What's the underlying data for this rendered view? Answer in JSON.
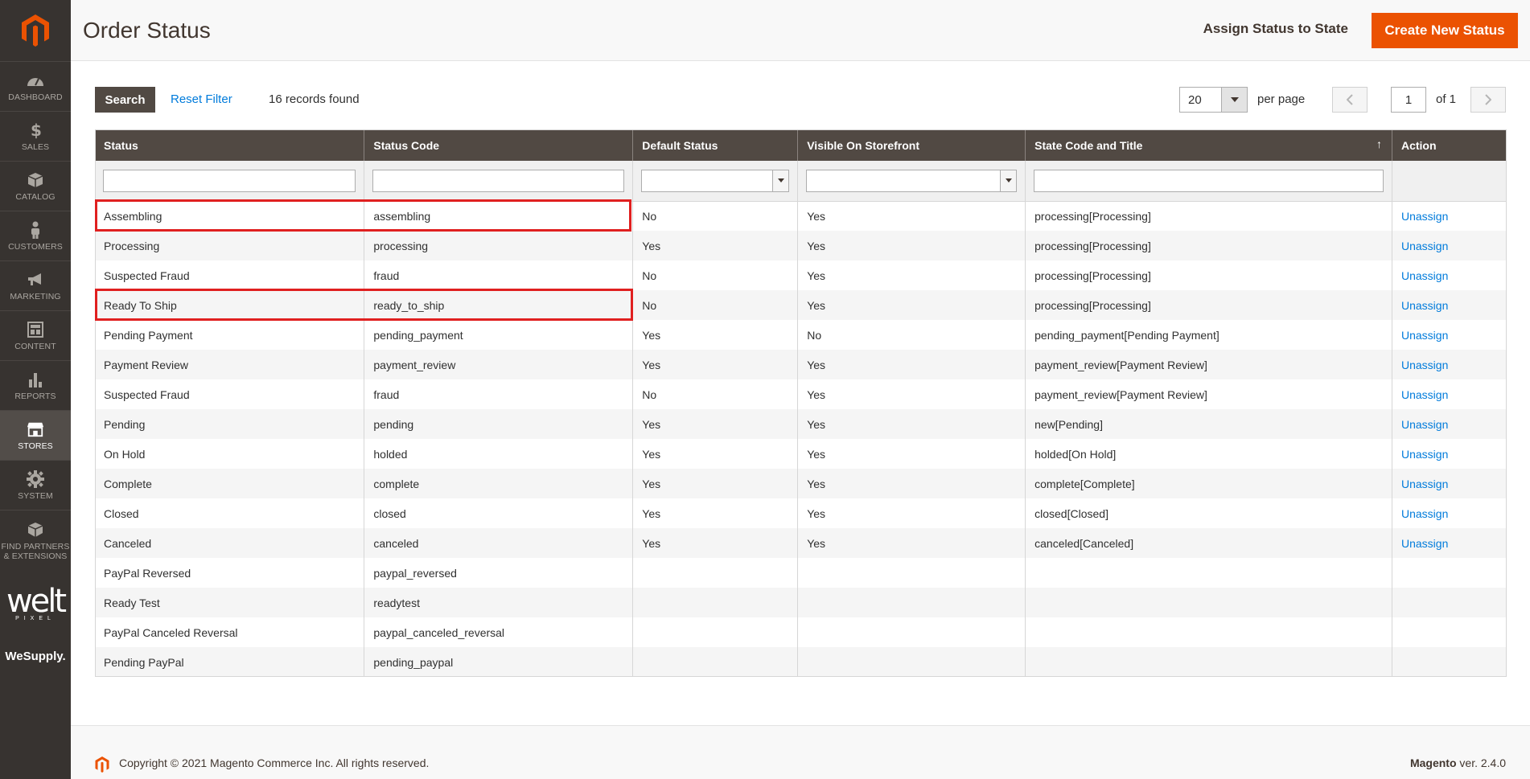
{
  "sidebar": {
    "items": [
      {
        "label": "DASHBOARD",
        "icon": "dashboard-icon",
        "active": false
      },
      {
        "label": "SALES",
        "icon": "dollar-icon",
        "active": false
      },
      {
        "label": "CATALOG",
        "icon": "box-icon",
        "active": false
      },
      {
        "label": "CUSTOMERS",
        "icon": "person-icon",
        "active": false
      },
      {
        "label": "MARKETING",
        "icon": "megaphone-icon",
        "active": false
      },
      {
        "label": "CONTENT",
        "icon": "layout-icon",
        "active": false
      },
      {
        "label": "REPORTS",
        "icon": "bar-chart-icon",
        "active": false
      },
      {
        "label": "STORES",
        "icon": "storefront-icon",
        "active": true
      },
      {
        "label": "SYSTEM",
        "icon": "gear-icon",
        "active": false
      },
      {
        "label": "FIND PARTNERS & EXTENSIONS",
        "icon": "cube-stack-icon",
        "active": false
      }
    ],
    "brand_welt": "welt",
    "brand_welt_sub": "PIXEL",
    "brand_wesupply": "WeSupply."
  },
  "header": {
    "title": "Order Status",
    "assign_label": "Assign Status to State",
    "create_label": "Create New Status"
  },
  "toolbar": {
    "search_label": "Search",
    "reset_label": "Reset Filter",
    "records_text": "16 records found",
    "per_page_value": "20",
    "per_page_label": "per page",
    "page_value": "1",
    "of_pages": "of 1"
  },
  "grid": {
    "columns": [
      "Status",
      "Status Code",
      "Default Status",
      "Visible On Storefront",
      "State Code and Title",
      "Action"
    ],
    "rows": [
      {
        "status": "Assembling",
        "code": "assembling",
        "default": "No",
        "visible": "Yes",
        "state": "processing[Processing]",
        "action": "Unassign"
      },
      {
        "status": "Processing",
        "code": "processing",
        "default": "Yes",
        "visible": "Yes",
        "state": "processing[Processing]",
        "action": "Unassign"
      },
      {
        "status": "Suspected Fraud",
        "code": "fraud",
        "default": "No",
        "visible": "Yes",
        "state": "processing[Processing]",
        "action": "Unassign"
      },
      {
        "status": "Ready To Ship",
        "code": "ready_to_ship",
        "default": "No",
        "visible": "Yes",
        "state": "processing[Processing]",
        "action": "Unassign"
      },
      {
        "status": "Pending Payment",
        "code": "pending_payment",
        "default": "Yes",
        "visible": "No",
        "state": "pending_payment[Pending Payment]",
        "action": "Unassign"
      },
      {
        "status": "Payment Review",
        "code": "payment_review",
        "default": "Yes",
        "visible": "Yes",
        "state": "payment_review[Payment Review]",
        "action": "Unassign"
      },
      {
        "status": "Suspected Fraud",
        "code": "fraud",
        "default": "No",
        "visible": "Yes",
        "state": "payment_review[Payment Review]",
        "action": "Unassign"
      },
      {
        "status": "Pending",
        "code": "pending",
        "default": "Yes",
        "visible": "Yes",
        "state": "new[Pending]",
        "action": "Unassign"
      },
      {
        "status": "On Hold",
        "code": "holded",
        "default": "Yes",
        "visible": "Yes",
        "state": "holded[On Hold]",
        "action": "Unassign"
      },
      {
        "status": "Complete",
        "code": "complete",
        "default": "Yes",
        "visible": "Yes",
        "state": "complete[Complete]",
        "action": "Unassign"
      },
      {
        "status": "Closed",
        "code": "closed",
        "default": "Yes",
        "visible": "Yes",
        "state": "closed[Closed]",
        "action": "Unassign"
      },
      {
        "status": "Canceled",
        "code": "canceled",
        "default": "Yes",
        "visible": "Yes",
        "state": "canceled[Canceled]",
        "action": "Unassign"
      },
      {
        "status": "PayPal Reversed",
        "code": "paypal_reversed",
        "default": "",
        "visible": "",
        "state": "",
        "action": ""
      },
      {
        "status": "Ready Test",
        "code": "readytest",
        "default": "",
        "visible": "",
        "state": "",
        "action": ""
      },
      {
        "status": "PayPal Canceled Reversal",
        "code": "paypal_canceled_reversal",
        "default": "",
        "visible": "",
        "state": "",
        "action": ""
      },
      {
        "status": "Pending PayPal",
        "code": "pending_paypal",
        "default": "",
        "visible": "",
        "state": "",
        "action": ""
      }
    ]
  },
  "footer": {
    "copyright": "Copyright © 2021 Magento Commerce Inc. All rights reserved.",
    "version_brand": "Magento",
    "version_text": " ver. 2.4.0"
  },
  "colors": {
    "accent": "#eb5202",
    "sidebar_bg": "#373330",
    "header_bg": "#514943",
    "link": "#007bdb",
    "highlight": "#e02020"
  }
}
